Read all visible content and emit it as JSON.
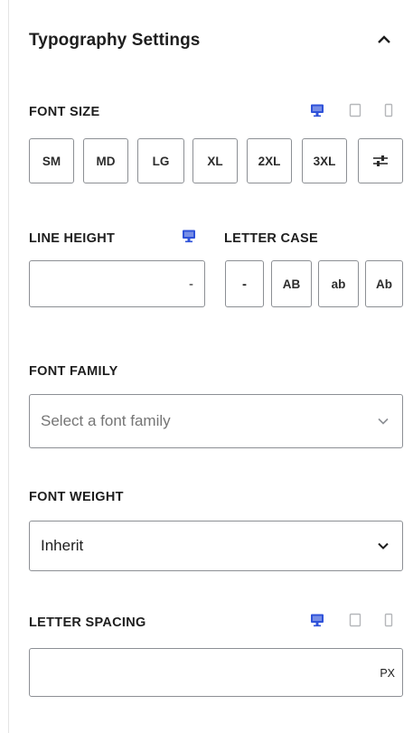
{
  "panel": {
    "title": "Typography Settings",
    "collapse_icon": "chevron-up-icon"
  },
  "font_size": {
    "label": "FONT SIZE",
    "devices": [
      "desktop-icon",
      "tablet-icon",
      "mobile-icon"
    ],
    "active_device": "desktop",
    "options": [
      "SM",
      "MD",
      "LG",
      "XL",
      "2XL",
      "3XL"
    ],
    "custom_icon": "sliders-icon"
  },
  "line_height": {
    "label": "LINE HEIGHT",
    "device": "desktop-icon",
    "value": "",
    "suffix": "-"
  },
  "letter_case": {
    "label": "LETTER CASE",
    "options": [
      "-",
      "AB",
      "ab",
      "Ab"
    ]
  },
  "font_family": {
    "label": "FONT FAMILY",
    "placeholder": "Select a font family"
  },
  "font_weight": {
    "label": "FONT WEIGHT",
    "selected": "Inherit"
  },
  "letter_spacing": {
    "label": "LETTER SPACING",
    "devices": [
      "desktop-icon",
      "tablet-icon",
      "mobile-icon"
    ],
    "active_device": "desktop",
    "value": "",
    "unit": "PX"
  },
  "colors": {
    "accent": "#2f52d9",
    "border": "#8c8f94",
    "muted_icon": "#c3c4c7"
  }
}
